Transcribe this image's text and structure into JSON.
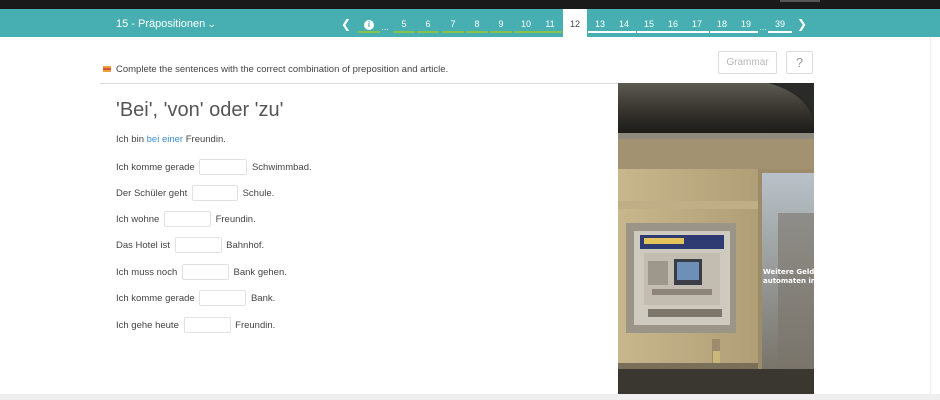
{
  "unit_selector": {
    "label": "15 - Präpositionen",
    "icon": "chevron-down-icon"
  },
  "pager": {
    "prev_icon": "chevron-left-icon",
    "next_icon": "chevron-right-icon",
    "info_label": "i",
    "ellipsis": "...",
    "pages": [
      "5",
      "6",
      "7",
      "8",
      "9",
      "10",
      "11",
      "12",
      "13",
      "14",
      "15",
      "16",
      "17",
      "18",
      "19",
      "39"
    ],
    "active": "12"
  },
  "toolbar": {
    "grammar_label": "Grammar",
    "help_label": "?"
  },
  "instruction": "Complete the sentences with the correct combination of preposition and article.",
  "exercise": {
    "title": "'Bei', 'von' oder 'zu'",
    "example": {
      "before": "Ich bin ",
      "answer": "bei einer",
      "after": " Freundin."
    },
    "rows": [
      {
        "before": "Ich komme gerade",
        "after": "Schwimmbad.",
        "value": ""
      },
      {
        "before": "Der Schüler geht",
        "after": "Schule.",
        "value": ""
      },
      {
        "before": "Ich wohne",
        "after": "Freundin.",
        "value": ""
      },
      {
        "before": "Das Hotel ist",
        "after": "Bahnhof.",
        "value": ""
      },
      {
        "before": "Ich muss noch",
        "after": "Bank gehen.",
        "value": ""
      },
      {
        "before": "Ich komme gerade",
        "after": "Bank.",
        "value": ""
      },
      {
        "before": "Ich gehe heute",
        "after": "Freundin.",
        "value": ""
      }
    ]
  },
  "photo": {
    "sign_line1": "Weitere Geld-",
    "sign_line2": "automaten in"
  },
  "colors": {
    "nav": "#47aeb1",
    "progress_done": "#8ac148",
    "answer": "#3b8fd3"
  }
}
